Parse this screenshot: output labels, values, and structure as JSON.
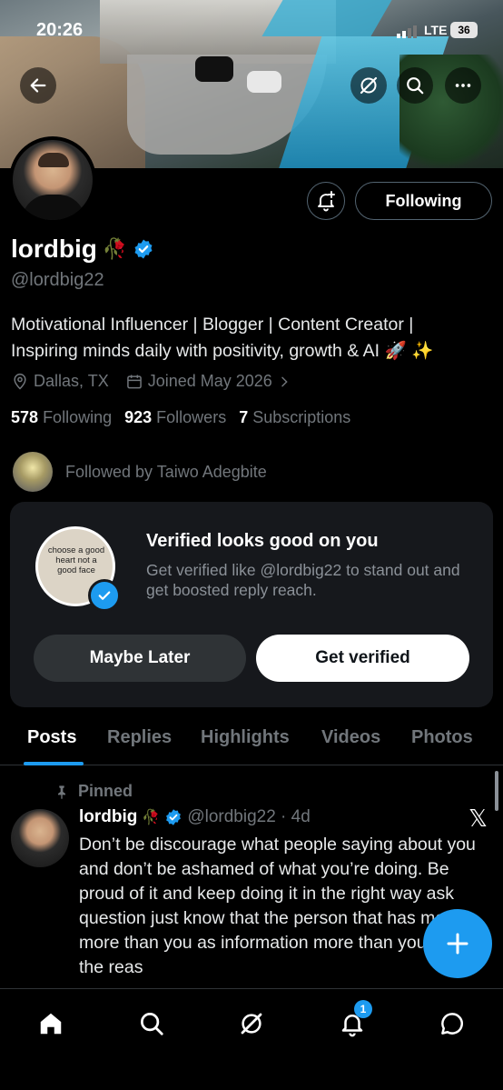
{
  "status_bar": {
    "time": "20:26",
    "network": "LTE",
    "battery": "36"
  },
  "header": {
    "back_icon": "arrow-left-icon",
    "grok_icon": "grok-icon",
    "search_icon": "search-icon",
    "more_icon": "more-icon"
  },
  "profile": {
    "display_name": "lordbig",
    "name_emoji": "🥀",
    "handle": "@lordbig22",
    "following_button": "Following",
    "bio_line1": "Motivational Influencer | Blogger | Content Creator |",
    "bio_line2": "Inspiring minds daily with positivity, growth & AI 🚀 ✨",
    "location": "Dallas, TX",
    "joined": "Joined May 2026",
    "following_count": "578",
    "following_label": "Following",
    "followers_count": "923",
    "followers_label": "Followers",
    "subscriptions_count": "7",
    "subscriptions_label": "Subscriptions",
    "followed_by": "Followed by Taiwo Adegbite"
  },
  "verified_card": {
    "pic_text": "choose a good heart not a good face",
    "title": "Verified looks good on you",
    "description": "Get verified like @lordbig22 to stand out and get boosted reply reach.",
    "later_button": "Maybe Later",
    "verify_button": "Get verified"
  },
  "tabs": [
    "Posts",
    "Replies",
    "Highlights",
    "Videos",
    "Photos"
  ],
  "post": {
    "pinned_label": "Pinned",
    "author": "lordbig",
    "author_emoji": "🥀",
    "handle_time": "@lordbig22 · 4d",
    "x_logo": "𝕏",
    "text": "Don’t be discourage what people saying about you and don’t be ashamed of what you’re doing. Be proud of it and keep doing it in the right way ask question just know that the person that has money more than you as information more than you. That’s the reas"
  },
  "bottom_nav": {
    "items": [
      "home-icon",
      "search-icon",
      "grok-icon",
      "notifications-icon",
      "messages-icon"
    ],
    "notification_badge": "1"
  },
  "colors": {
    "accent": "#1d9bf0",
    "background": "#000000",
    "muted": "#71767b"
  }
}
